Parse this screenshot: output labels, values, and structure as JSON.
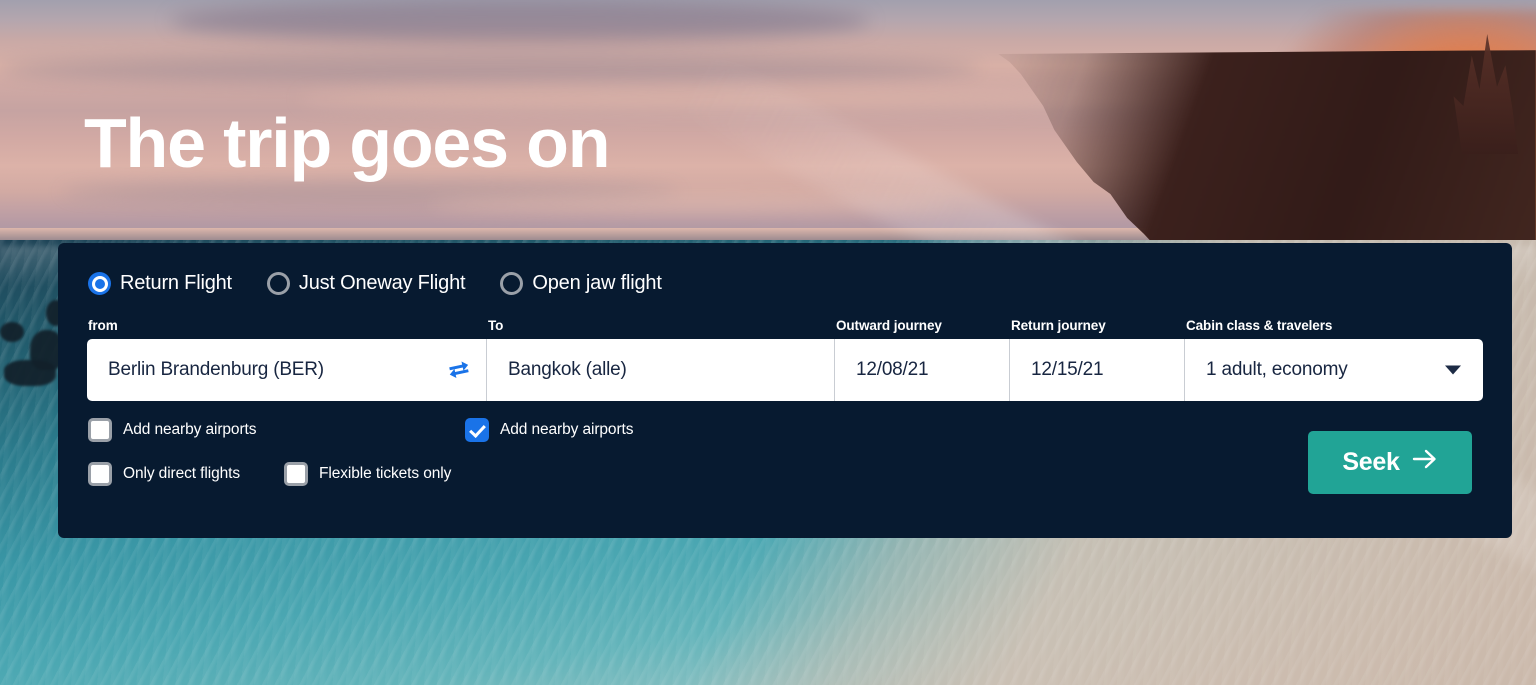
{
  "hero": {
    "headline": "The trip goes on"
  },
  "search_panel": {
    "trip_types": [
      {
        "label": "Return Flight",
        "selected": true,
        "icon": "radio-selected-icon"
      },
      {
        "label": "Just Oneway Flight",
        "selected": false,
        "icon": "radio-unselected-icon"
      },
      {
        "label": "Open jaw flight",
        "selected": false,
        "icon": "radio-unselected-icon"
      }
    ],
    "fields": {
      "from": {
        "label": "from",
        "value": "Berlin Brandenburg (BER)"
      },
      "to": {
        "label": "To",
        "value": "Bangkok (alle)"
      },
      "outward": {
        "label": "Outward journey",
        "value": "12/08/21"
      },
      "return": {
        "label": "Return journey",
        "value": "12/15/21"
      },
      "cabin": {
        "label": "Cabin class & travelers",
        "value": "1 adult, economy"
      }
    },
    "icons": {
      "swap": "swap-arrows-icon",
      "caret": "chevron-down-icon"
    },
    "checkboxes": [
      {
        "label": "Add nearby airports",
        "checked": false
      },
      {
        "label": "Add nearby airports",
        "checked": true
      },
      {
        "label": "Only direct flights",
        "checked": false
      },
      {
        "label": "Flexible tickets only",
        "checked": false
      }
    ],
    "submit": {
      "label": "Seek",
      "icon": "arrow-right-icon"
    }
  },
  "colors": {
    "panel_bg": "#071a30",
    "accent_blue": "#1a73e8",
    "accent_teal": "#21a496",
    "field_bg": "#ffffff",
    "text_light": "#ffffff",
    "text_dark": "#182641"
  }
}
